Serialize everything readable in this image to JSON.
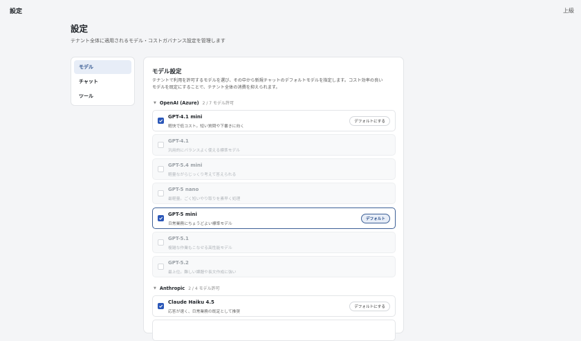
{
  "header": {
    "app_title": "設定",
    "top_link": "上級"
  },
  "page": {
    "title": "設定",
    "subtitle": "テナント全体に適用されるモデル・コストガバナンス設定を管理します"
  },
  "sidebar": {
    "items": [
      {
        "label": "モデル",
        "active": true
      },
      {
        "label": "チャット",
        "active": false
      },
      {
        "label": "ツール",
        "active": false
      }
    ]
  },
  "panel": {
    "title": "モデル設定",
    "description_line1": "テナントで利用を許可するモデルを選び、その中から新規チャットのデフォルトモデルを指定します。コスト効率の良い",
    "description_line2": "モデルを既定にすることで、テナント全体の消費を抑えられます。"
  },
  "groups": [
    {
      "name": "OpenAI (Azure)",
      "count": "2 / 7 モデル許可",
      "models": [
        {
          "name": "GPT-4.1 mini",
          "desc": "軽快で低コスト。短い質問や下書きに向く",
          "checked": true,
          "button": "デフォルトにする",
          "is_default": false
        },
        {
          "name": "GPT-4.1",
          "desc": "汎用的にバランスよく使える標準モデル",
          "checked": false
        },
        {
          "name": "GPT-5.4 mini",
          "desc": "軽量ながらじっくり考えて答えられる",
          "checked": false
        },
        {
          "name": "GPT-5 nano",
          "desc": "最軽量。ごく短いやり取りを素早く処理",
          "checked": false
        },
        {
          "name": "GPT-5 mini",
          "desc": "日常業務にちょうどよい標準モデル",
          "checked": true,
          "button": "デフォルト",
          "is_default": true
        },
        {
          "name": "GPT-5.1",
          "desc": "複雑な作業もこなせる高性能モデル",
          "checked": false
        },
        {
          "name": "GPT-5.2",
          "desc": "最上位。難しい課題や長文作成に強い",
          "checked": false
        }
      ]
    },
    {
      "name": "Anthropic",
      "count": "2 / 4 モデル許可",
      "models": [
        {
          "name": "Claude Haiku 4.5",
          "desc": "応答が速く、日常業務の既定として推奨",
          "checked": true,
          "button": "デフォルトにする",
          "is_default": false
        }
      ]
    }
  ],
  "colors": {
    "accent": "#2b57b8",
    "selected_border": "#3c5f96",
    "sidebar_active_bg": "#e7edf7"
  }
}
